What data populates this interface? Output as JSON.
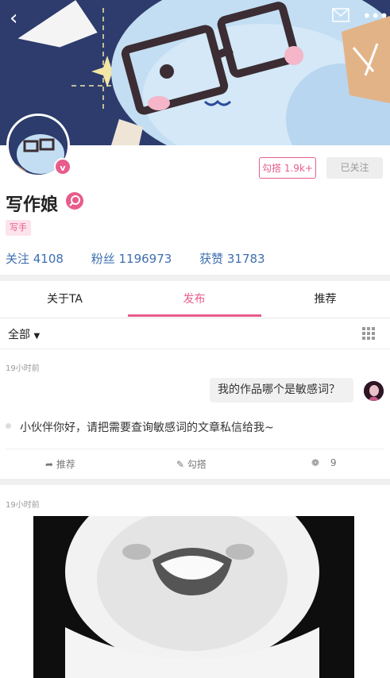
{
  "header": {
    "back_icon": "back-arrow-icon",
    "mail_icon": "mail-icon",
    "more_icon": "more-icon"
  },
  "profile": {
    "name": "写作娘",
    "role_tag": "写手",
    "badge": "v",
    "tag_button": "勾搭 1.9k+",
    "follow_button": "已关注",
    "stats": {
      "following": "关注 4108",
      "fans": "粉丝 1196973",
      "likes": "获赞 31783"
    }
  },
  "tabs": [
    "关于TA",
    "发布",
    "推荐"
  ],
  "active_tab": "发布",
  "filter": {
    "label": "全部"
  },
  "posts": [
    {
      "time": "19小时前",
      "question": "我的作品哪个是敏感词？",
      "text": "小伙伴你好，请把需要查询敏感词的文章私信给我~",
      "actions": {
        "recommend": "推荐",
        "gouda": "勾搭",
        "paw_count": "9"
      }
    },
    {
      "time": "19小时前"
    }
  ],
  "colors": {
    "accent": "#e85c8c",
    "stat_blue": "#3e6fb0",
    "banner_bg": "#2c3c6c"
  }
}
